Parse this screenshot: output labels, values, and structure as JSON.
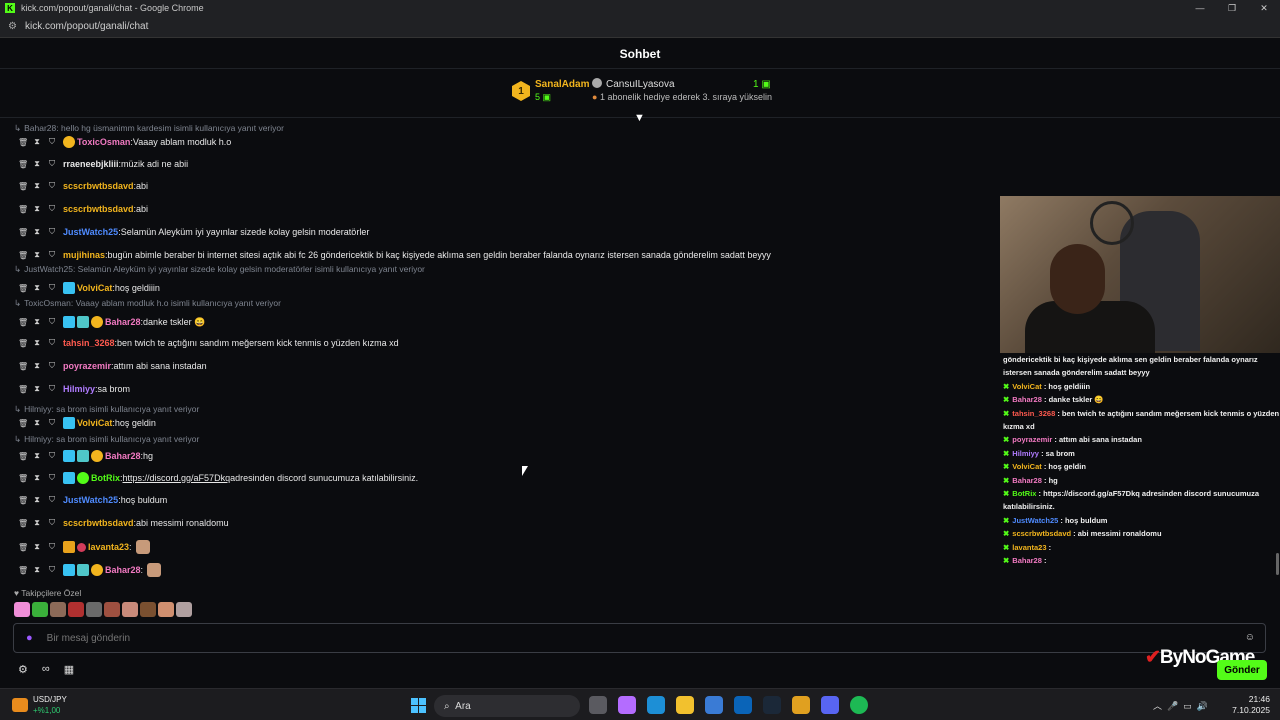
{
  "window": {
    "title": "kick.com/popout/ganali/chat - Google Chrome",
    "url": "kick.com/popout/ganali/chat",
    "controls": [
      "—",
      "❐",
      "✕"
    ]
  },
  "chat": {
    "header_title": "Sohbet",
    "pinned": {
      "rank": "1",
      "leader_name": "SanalAdam",
      "leader_count": "5",
      "second_name": "CansuILyasova",
      "gift_count": "1",
      "hint": "1 abonelik hediye ederek 3. sıraya yükselin"
    },
    "reply_prefix": "↳",
    "messages": [
      {
        "kind": "reply",
        "text": "Bahar28: hello hg üsmanimm kardesim isimli kullanıcıya yanıt veriyor"
      },
      {
        "kind": "msg",
        "user": "ToxicOsman",
        "color": "#f27ac2",
        "badges": [
          "sub"
        ],
        "text": "Vaaay ablam modluk h.o"
      },
      {
        "kind": "msg",
        "user": "rraeneebjkliii",
        "color": "#e8e8e8",
        "badges": [],
        "text": "müzik adi ne abii"
      },
      {
        "kind": "msg",
        "user": "scscrbwtbsdavd",
        "color": "#f2b51e",
        "badges": [],
        "text": "abi"
      },
      {
        "kind": "msg",
        "user": "scscrbwtbsdavd",
        "color": "#f2b51e",
        "badges": [],
        "text": "abi"
      },
      {
        "kind": "msg",
        "user": "JustWatch25",
        "color": "#4f8bff",
        "badges": [],
        "text": "Selamün Aleyküm iyi yayınlar sizede kolay gelsin moderatörler"
      },
      {
        "kind": "msg",
        "user": "mujihinas",
        "color": "#f2b51e",
        "badges": [],
        "text": "bugün abimle beraber bi internet sitesi açtık abi fc 26 göndericektik bi kaç kişiyede aklıma sen geldin beraber falanda oynarız istersen sanada gönderelim sadatt beyyy"
      },
      {
        "kind": "reply",
        "text": "JustWatch25: Selamün Aleyküm iyi yayınlar sizede kolay gelsin moderatörler isimli kullanıcıya yanıt veriyor"
      },
      {
        "kind": "msg",
        "user": "VolviCat",
        "color": "#f2b51e",
        "badges": [
          "vip"
        ],
        "text": "hoş geldiiin"
      },
      {
        "kind": "reply",
        "text": "ToxicOsman: Vaaay ablam modluk h.o isimli kullanıcıya yanıt veriyor"
      },
      {
        "kind": "msg",
        "user": "Bahar28",
        "color": "#f27ac2",
        "badges": [
          "vip",
          "og",
          "sub"
        ],
        "text": "danke tskler 😄"
      },
      {
        "kind": "msg",
        "user": "tahsin_3268",
        "color": "#ff5a4f",
        "badges": [],
        "text": "ben twich te açtığını sandım meğersem kick tenmis o yüzden kızma xd"
      },
      {
        "kind": "msg",
        "user": "poyrazemir",
        "color": "#f27ac2",
        "badges": [],
        "text": "attım abi sana instadan"
      },
      {
        "kind": "msg",
        "user": "Hilmiyy",
        "color": "#b07cff",
        "badges": [],
        "text": "sa brom"
      },
      {
        "kind": "reply",
        "text": "Hilmiyy: sa brom isimli kullanıcıya yanıt veriyor"
      },
      {
        "kind": "msg",
        "user": "VolviCat",
        "color": "#f2b51e",
        "badges": [
          "vip"
        ],
        "text": "hoş geldin"
      },
      {
        "kind": "reply",
        "text": "Hilmiyy: sa brom isimli kullanıcıya yanıt veriyor"
      },
      {
        "kind": "msg",
        "user": "Bahar28",
        "color": "#f27ac2",
        "badges": [
          "vip",
          "og",
          "sub"
        ],
        "text": "hg"
      },
      {
        "kind": "msg",
        "user": "BotRix",
        "color": "#53fc18",
        "badges": [
          "vip",
          "bot"
        ],
        "link": "https://discord.gg/aF57Dkq",
        "text": "adresinden discord sunucumuza katılabilirsiniz."
      },
      {
        "kind": "msg",
        "user": "JustWatch25",
        "color": "#4f8bff",
        "badges": [],
        "text": "hoş buldum"
      },
      {
        "kind": "msg",
        "user": "scscrbwtbsdavd",
        "color": "#f2b51e",
        "badges": [],
        "text": "abi messimi ronaldomu"
      },
      {
        "kind": "msg",
        "user": "lavanta23",
        "color": "#f2b51e",
        "badges": [
          "crown",
          "red"
        ],
        "text": "",
        "emote": true
      },
      {
        "kind": "msg",
        "user": "Bahar28",
        "color": "#f27ac2",
        "badges": [
          "vip",
          "og",
          "sub"
        ],
        "text": "",
        "emote": true
      }
    ],
    "emote_section_label": "♥ Takipçilere Özel",
    "input_placeholder": "Bir mesaj gönderin",
    "send_label": "Gönder"
  },
  "overlay": {
    "lines": [
      {
        "user": "",
        "text": "göndericektik bi kaç kişiyede aklıma sen geldin beraber falanda oynarız istersen sanada gönderelim sadatt beyyy",
        "color": "#f0f0f0",
        "wrap": true
      },
      {
        "user": "VolviCat",
        "text": "hoş geldiiin",
        "color": "#f2b51e"
      },
      {
        "user": "Bahar28",
        "text": "danke tskler 😄",
        "color": "#f27ac2"
      },
      {
        "user": "tahsin_3268",
        "text": "ben twich te açtığını sandım meğersem kick tenmis o yüzden kızma xd",
        "color": "#ff5a4f",
        "wrap": true
      },
      {
        "user": "poyrazemir",
        "text": "attım abi sana instadan",
        "color": "#f27ac2"
      },
      {
        "user": "Hilmiyy",
        "text": "sa brom",
        "color": "#b07cff"
      },
      {
        "user": "VolviCat",
        "text": "hoş geldin",
        "color": "#f2b51e"
      },
      {
        "user": "Bahar28",
        "text": "hg",
        "color": "#f27ac2"
      },
      {
        "user": "BotRix",
        "text": "https://discord.gg/aF57Dkq adresinden discord sunucumuza katılabilirsiniz.",
        "color": "#53fc18",
        "wrap": true
      },
      {
        "user": "JustWatch25",
        "text": "hoş buldum",
        "color": "#4f8bff"
      },
      {
        "user": "scscrbwtbsdavd",
        "text": "abi messimi ronaldomu",
        "color": "#f2b51e"
      },
      {
        "user": "lavanta23",
        "text": "",
        "color": "#f2b51e"
      },
      {
        "user": "Bahar28",
        "text": "",
        "color": "#f27ac2"
      }
    ],
    "watermark": "ByNoGame"
  },
  "taskbar": {
    "stock_name": "USD/JPY",
    "stock_change": "+%1,00",
    "search_label": "Ara",
    "time": "21:46",
    "date": "7.10.2025"
  }
}
